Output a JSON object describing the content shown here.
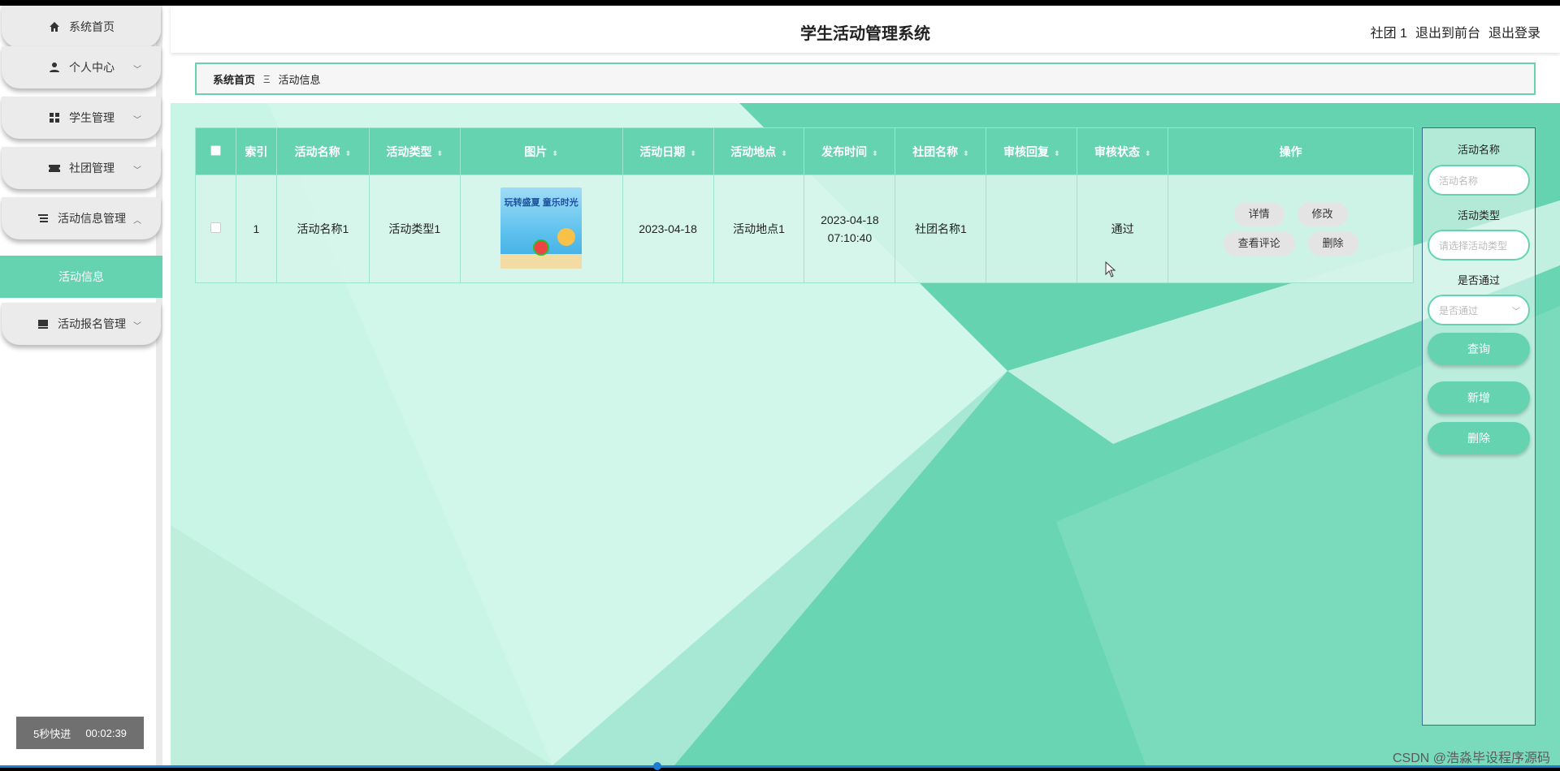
{
  "app": {
    "title": "学生活动管理系统",
    "user_label": "社团 1",
    "exit_front_label": "退出到前台",
    "logout_label": "退出登录"
  },
  "sidebar": {
    "items": [
      {
        "label": "系统首页",
        "icon": "home-icon"
      },
      {
        "label": "个人中心",
        "icon": "user-icon"
      },
      {
        "label": "学生管理",
        "icon": "grid-icon"
      },
      {
        "label": "社团管理",
        "icon": "ticket-icon"
      },
      {
        "label": "活动信息管理",
        "icon": "list-icon"
      },
      {
        "label": "活动报名管理",
        "icon": "inbox-icon"
      }
    ],
    "active_sub": "活动信息"
  },
  "breadcrumb": {
    "home": "系统首页",
    "separator": "Ξ",
    "current": "活动信息"
  },
  "table": {
    "columns": [
      "索引",
      "活动名称",
      "活动类型",
      "图片",
      "活动日期",
      "活动地点",
      "发布时间",
      "社团名称",
      "审核回复",
      "审核状态",
      "操作"
    ],
    "rows": [
      {
        "index": "1",
        "name": "活动名称1",
        "type": "活动类型1",
        "image_text": "玩转盛夏 童乐时光",
        "date": "2023-04-18",
        "location": "活动地点1",
        "publish_time": "2023-04-18 07:10:40",
        "club": "社团名称1",
        "reply": "",
        "status": "通过"
      }
    ],
    "actions": {
      "detail": "详情",
      "edit": "修改",
      "comments": "查看评论",
      "delete": "删除"
    }
  },
  "search": {
    "name_label": "活动名称",
    "name_placeholder": "活动名称",
    "type_label": "活动类型",
    "type_placeholder": "请选择活动类型",
    "pass_label": "是否通过",
    "pass_placeholder": "是否通过",
    "query_button": "查询",
    "add_button": "新增",
    "delete_button": "删除"
  },
  "player": {
    "fast_forward": "5秒快进",
    "time": "00:02:39"
  },
  "watermark": "CSDN @浩淼毕设程序源码",
  "colors": {
    "accent": "#66d3b0",
    "content_bg": "#c8f5e6"
  }
}
